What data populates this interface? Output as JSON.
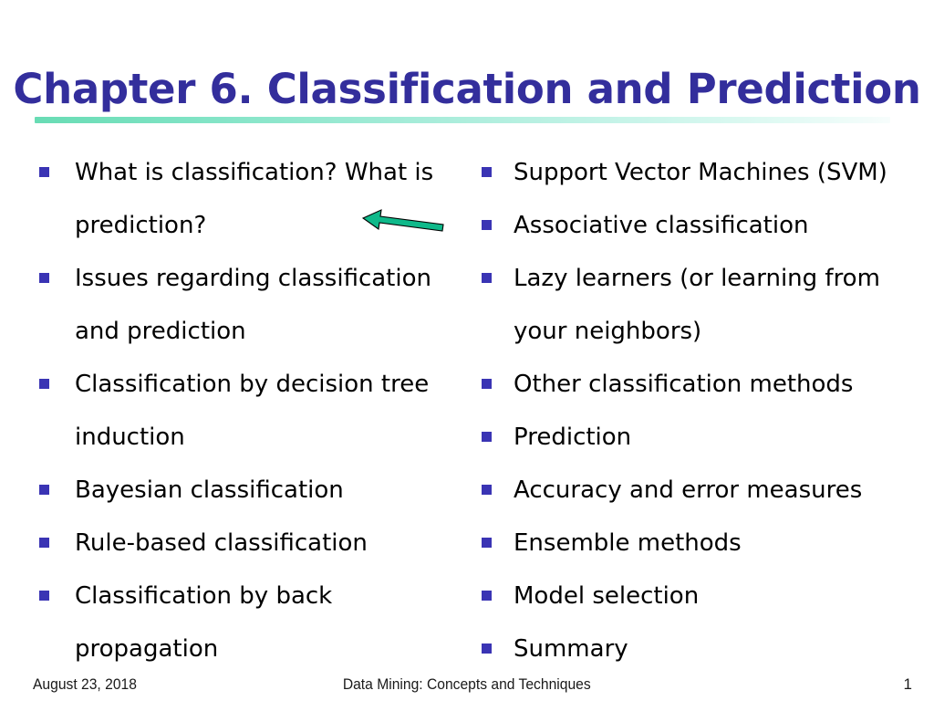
{
  "slide": {
    "title": "Chapter 6. Classification and Prediction",
    "title_color": "#332E9C",
    "divider_color": "#68DCB4",
    "background_color": "#FFFFFF",
    "bullet_color": "#3A34B4",
    "text_color": "#000000"
  },
  "left_column": {
    "items": [
      {
        "text": "What is classification? What is prediction?"
      },
      {
        "text": "Issues regarding classification and prediction"
      },
      {
        "text": "Classification by decision tree induction"
      },
      {
        "text": "Bayesian classification"
      },
      {
        "text": "Rule-based classification"
      },
      {
        "text": "Classification by back propagation"
      }
    ]
  },
  "right_column": {
    "items": [
      {
        "text": "Support Vector Machines (SVM)"
      },
      {
        "text": "Associative classification"
      },
      {
        "text": "Lazy learners (or learning from your neighbors)"
      },
      {
        "text": "Other classification methods"
      },
      {
        "text": "Prediction"
      },
      {
        "text": "Accuracy and error measures"
      },
      {
        "text": "Ensemble methods"
      },
      {
        "text": "Model selection"
      },
      {
        "text": "Summary"
      }
    ]
  },
  "annotation": {
    "arrow_direction": "left",
    "arrow_color": "#0FB98A",
    "arrow_outline_color": "#000000"
  },
  "footer": {
    "date": "August 23, 2018",
    "center": "Data Mining: Concepts and Techniques",
    "page_number": "1"
  }
}
